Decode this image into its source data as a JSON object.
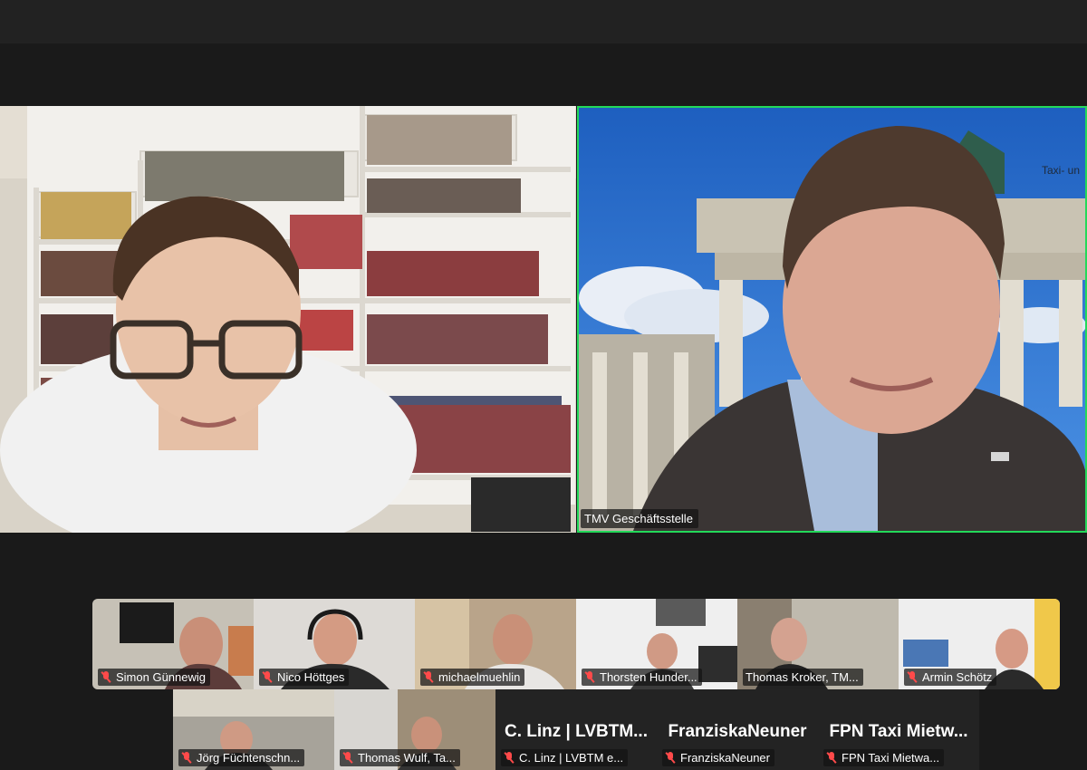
{
  "speakers": [
    {
      "name": ""
    },
    {
      "name": "TMV Geschäftsstelle",
      "background_text": "Taxi- un"
    }
  ],
  "gallery": {
    "row1": [
      {
        "name": "Simon Günnewig",
        "muted": true
      },
      {
        "name": "Nico Höttges",
        "muted": true
      },
      {
        "name": "michaelmuehlin",
        "muted": true
      },
      {
        "name": "Thorsten Hunder...",
        "muted": true
      },
      {
        "name": "Thomas Kroker, TM...",
        "muted": false
      },
      {
        "name": "Armin Schötz",
        "muted": true
      }
    ],
    "row2": [
      {
        "name": "Jörg Füchtenschn...",
        "muted": true,
        "video": true
      },
      {
        "name": "Thomas Wulf, Ta...",
        "muted": true,
        "video": true
      },
      {
        "name": "C. Linz | LVBTM e...",
        "display_name": "C. Linz | LVBTM...",
        "muted": true,
        "video": false
      },
      {
        "name": "FranziskaNeuner",
        "display_name": "FranziskaNeuner",
        "muted": true,
        "video": false
      },
      {
        "name": "FPN Taxi Mietwa...",
        "display_name": "FPN Taxi Mietw...",
        "muted": true,
        "video": false
      }
    ]
  },
  "colors": {
    "active_speaker_border": "#23d959",
    "muted_icon": "#ff4a4a",
    "background": "#1a1a1a"
  }
}
